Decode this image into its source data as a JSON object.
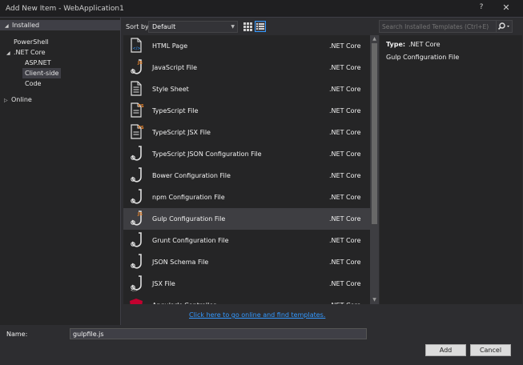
{
  "window": {
    "title": "Add New Item - WebApplication1",
    "help_label": "?",
    "close_label": "✕"
  },
  "tree": {
    "header": "Installed",
    "items": [
      {
        "label": "PowerShell"
      },
      {
        "label": ".NET Core"
      },
      {
        "label": "ASP.NET"
      },
      {
        "label": "Client-side"
      },
      {
        "label": "Code"
      },
      {
        "label": "Online"
      }
    ]
  },
  "toolbar": {
    "sort_label": "Sort by:",
    "sort_value": "Default"
  },
  "search": {
    "placeholder": "Search Installed Templates (Ctrl+E)"
  },
  "templates": [
    {
      "name": "HTML Page",
      "type": ".NET Core",
      "icon": "html-page-icon"
    },
    {
      "name": "JavaScript File",
      "type": ".NET Core",
      "icon": "javascript-file-icon"
    },
    {
      "name": "Style Sheet",
      "type": ".NET Core",
      "icon": "stylesheet-icon"
    },
    {
      "name": "TypeScript File",
      "type": ".NET Core",
      "icon": "typescript-file-icon"
    },
    {
      "name": "TypeScript JSX File",
      "type": ".NET Core",
      "icon": "typescript-jsx-icon"
    },
    {
      "name": "TypeScript JSON Configuration File",
      "type": ".NET Core",
      "icon": "json-config-icon"
    },
    {
      "name": "Bower Configuration File",
      "type": ".NET Core",
      "icon": "bower-config-icon"
    },
    {
      "name": "npm Configuration File",
      "type": ".NET Core",
      "icon": "npm-config-icon"
    },
    {
      "name": "Gulp Configuration File",
      "type": ".NET Core",
      "icon": "gulp-config-icon"
    },
    {
      "name": "Grunt Configuration File",
      "type": ".NET Core",
      "icon": "grunt-config-icon"
    },
    {
      "name": "JSON Schema File",
      "type": ".NET Core",
      "icon": "json-schema-icon"
    },
    {
      "name": "JSX File",
      "type": ".NET Core",
      "icon": "jsx-file-icon"
    },
    {
      "name": "AngularJs Controller",
      "type": ".NET Core",
      "icon": "angular-controller-icon"
    }
  ],
  "details": {
    "type_label": "Type:",
    "type_value": ".NET Core",
    "name": "Gulp Configuration File"
  },
  "online_link": "Click here to go online and find templates.",
  "name_field": {
    "label": "Name:",
    "value": "gulpfile.js"
  },
  "buttons": {
    "add": "Add",
    "cancel": "Cancel"
  },
  "colors": {
    "accent": "#3399ff",
    "js_badge": "#e8832a",
    "ts_badge": "#e8832a",
    "angular": "#c3002f"
  }
}
